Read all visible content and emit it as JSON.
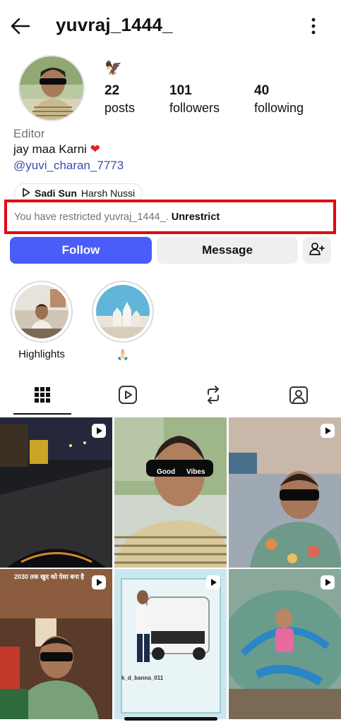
{
  "header": {
    "username": "yuvraj_1444_",
    "back_icon": "arrow-left-icon",
    "more_icon": "vertical-dots-icon"
  },
  "profile": {
    "note_emoji": "🦅",
    "stats": [
      {
        "value": "22",
        "label": "posts"
      },
      {
        "value": "101",
        "label": "followers"
      },
      {
        "value": "40",
        "label": "following"
      }
    ],
    "category": "Editor",
    "bio_text": "jay maa Karni",
    "bio_emoji": "❤",
    "mention": "@yuvi_charan_7773",
    "music": {
      "song": "Sadi Sun",
      "artist": "Harsh Nussi"
    }
  },
  "restricted_banner": {
    "message": "You have restricted yuvraj_1444_.",
    "action": "Unrestrict"
  },
  "actions": {
    "follow": "Follow",
    "message": "Message"
  },
  "highlights": [
    {
      "label": "Highlights"
    },
    {
      "label": "🙏🏻"
    }
  ],
  "tabs": [
    "grid-icon",
    "reels-icon",
    "reposts-icon",
    "tagged-icon"
  ],
  "grid": {
    "post_captions": {
      "selfie_goggles_left": "Good",
      "selfie_goggles_right": "Vibes",
      "overlay_text": "2030 तक खुद को ऐसा बना है",
      "watermark": "k_d_banna_011"
    }
  },
  "colors": {
    "accent_blue": "#4a5df9",
    "link_blue": "#3b4fb0",
    "restricted_border": "#e30613",
    "secondary_gray": "#737373",
    "button_gray": "#efefef"
  }
}
